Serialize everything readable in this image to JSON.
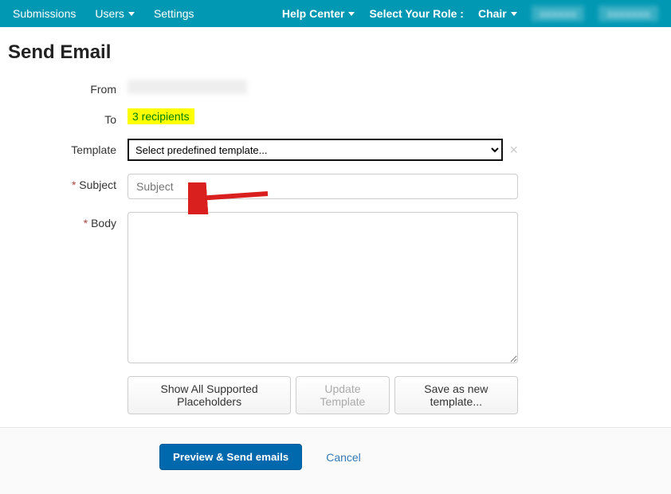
{
  "nav": {
    "left": {
      "submissions": "Submissions",
      "users": "Users",
      "settings": "Settings"
    },
    "right": {
      "help": "Help Center",
      "select_role": "Select Your Role :",
      "role": "Chair"
    }
  },
  "page": {
    "title": "Send Email"
  },
  "labels": {
    "from": "From",
    "to": "To",
    "template": "Template",
    "subject": "Subject",
    "body": "Body"
  },
  "form": {
    "to_link": "3 recipients",
    "template_placeholder": "Select predefined template...",
    "subject_placeholder": "Subject",
    "body_value": ""
  },
  "buttons": {
    "show_placeholders": "Show All Supported Placeholders",
    "update_template": "Update Template",
    "save_template": "Save as new template...",
    "preview": "Preview & Send emails",
    "cancel": "Cancel"
  }
}
